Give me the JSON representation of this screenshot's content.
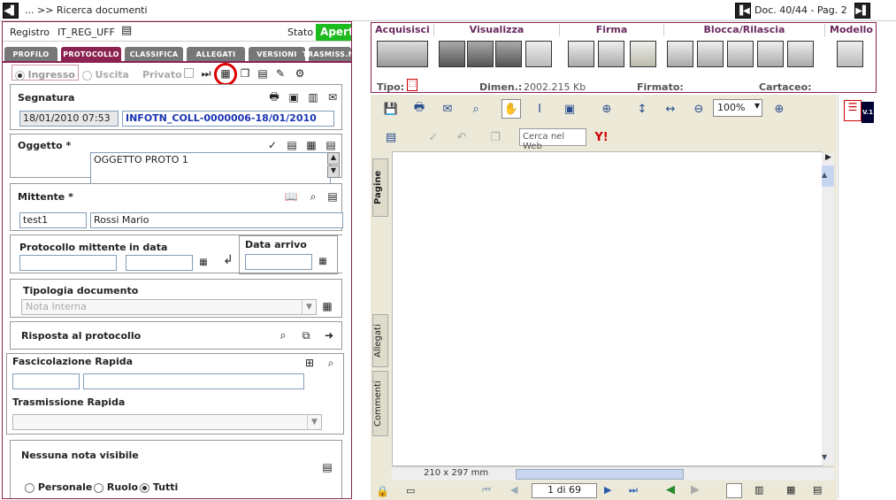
{
  "topbar": {
    "breadcrumb": "... >> Ricerca documenti",
    "doc_pos": "Doc. 40/44 - Pag. 2"
  },
  "header": {
    "registro_label": "Registro",
    "registro_value": "IT_REG_UFF",
    "stato_label": "Stato",
    "stato_value": "Aperto"
  },
  "tabs": [
    "PROFILO",
    "PROTOCOLLO",
    "CLASSIFICA",
    "ALLEGATI",
    "VERSIONI",
    "TRASMISS.NI"
  ],
  "direction": {
    "ingresso": "Ingresso",
    "uscita": "Uscita",
    "privato": "Privato"
  },
  "segnatura": {
    "title": "Segnatura",
    "date": "18/01/2010 07:53",
    "value": "INFOTN_COLL-0000006-18/01/2010"
  },
  "oggetto": {
    "title": "Oggetto *",
    "value": "OGGETTO PROTO 1"
  },
  "mittente": {
    "title": "Mittente *",
    "code": "test1",
    "name": "Rossi Mario"
  },
  "protocollo_mittente": {
    "title": "Protocollo mittente",
    "in_data": "in data",
    "data_arrivo": "Data arrivo"
  },
  "tipologia": {
    "title": "Tipologia documento",
    "value": "Nota Interna"
  },
  "risposta": {
    "title": "Risposta al protocollo"
  },
  "fascicolazione": {
    "title": "Fascicolazione Rapida",
    "trasmissione": "Trasmissione Rapida"
  },
  "note": {
    "title": "Nessuna nota visibile",
    "personale": "Personale",
    "ruolo": "Ruolo",
    "tutti": "Tutti"
  },
  "toolbar": {
    "groups": [
      "Acquisisci",
      "Visualizza",
      "Firma",
      "Blocca/Rilascia",
      "Modello"
    ],
    "tipo_label": "Tipo:",
    "dimen_label": "Dimen.:",
    "dimen_value": "2002.215 Kb",
    "firmato_label": "Firmato:",
    "cartaceo_label": "Cartaceo:"
  },
  "pdf": {
    "zoom": "100%",
    "search_placeholder": "Cerca nel Web",
    "page_size": "210 x 297 mm",
    "page_info": "1 di 69",
    "side_tabs": [
      "Pagine",
      "Allegati",
      "Commenti"
    ],
    "version": "V.1"
  }
}
